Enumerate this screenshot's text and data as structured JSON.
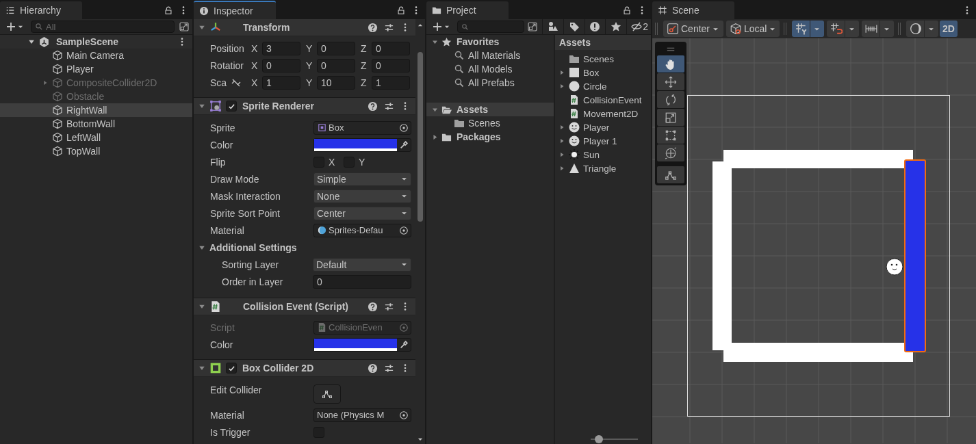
{
  "hierarchy": {
    "title": "Hierarchy",
    "search_placeholder": "All",
    "scene": {
      "name": "SampleScene",
      "expanded": true,
      "children": [
        {
          "name": "Main Camera",
          "selected": false,
          "active": true,
          "expandable": false
        },
        {
          "name": "Player",
          "selected": false,
          "active": true,
          "expandable": false
        },
        {
          "name": "CompositeCollider2D",
          "selected": false,
          "active": false,
          "expandable": true,
          "expanded": false
        },
        {
          "name": "Obstacle",
          "selected": false,
          "active": false,
          "expandable": false
        },
        {
          "name": "RightWall",
          "selected": true,
          "active": true,
          "expandable": false
        },
        {
          "name": "BottomWall",
          "selected": false,
          "active": true,
          "expandable": false
        },
        {
          "name": "LeftWall",
          "selected": false,
          "active": true,
          "expandable": false
        },
        {
          "name": "TopWall",
          "selected": false,
          "active": true,
          "expandable": false
        }
      ]
    }
  },
  "inspector": {
    "title": "Inspector",
    "components": [
      {
        "kind": "transform",
        "title": "Transform",
        "expanded": true,
        "rows": [
          {
            "kind": "vector3",
            "label": "Position",
            "values": [
              {
                "axis": "X",
                "value": "3"
              },
              {
                "axis": "Y",
                "value": "0"
              },
              {
                "axis": "Z",
                "value": "0"
              }
            ]
          },
          {
            "kind": "vector3",
            "label": "Rotatior",
            "values": [
              {
                "axis": "X",
                "value": "0"
              },
              {
                "axis": "Y",
                "value": "0"
              },
              {
                "axis": "Z",
                "value": "0"
              }
            ]
          },
          {
            "kind": "vector3",
            "label": "Sca",
            "ratio_locked": false,
            "values": [
              {
                "axis": "X",
                "value": "1"
              },
              {
                "axis": "Y",
                "value": "10"
              },
              {
                "axis": "Z",
                "value": "1"
              }
            ]
          }
        ]
      },
      {
        "kind": "sprite_renderer",
        "title": "Sprite Renderer",
        "enabled": true,
        "expanded": true,
        "rows": [
          {
            "kind": "sprite_object",
            "label": "Sprite",
            "value": "Box",
            "disabled": false
          },
          {
            "kind": "color",
            "label": "Color",
            "color": "#2632e8"
          },
          {
            "kind": "flip",
            "label": "Flip",
            "options": [
              {
                "axis": "X",
                "checked": false
              },
              {
                "axis": "Y",
                "checked": false
              }
            ]
          },
          {
            "kind": "dropdown",
            "label": "Draw Mode",
            "value": "Simple"
          },
          {
            "kind": "dropdown",
            "label": "Mask Interaction",
            "value": "None"
          },
          {
            "kind": "dropdown",
            "label": "Sprite Sort Point",
            "value": "Center"
          },
          {
            "kind": "material_object",
            "label": "Material",
            "value": "Sprites-Defau",
            "disabled": false
          },
          {
            "kind": "foldout",
            "label": "Additional Settings",
            "expanded": true,
            "children": [
              {
                "kind": "dropdown",
                "label": "Sorting Layer",
                "value": "Default"
              },
              {
                "kind": "number",
                "label": "Order in Layer",
                "value": "0"
              }
            ]
          }
        ]
      },
      {
        "kind": "script",
        "title": "Collision Event (Script)",
        "expanded": true,
        "rows": [
          {
            "kind": "script_object",
            "label": "Script",
            "value": "CollisionEven",
            "disabled": true
          },
          {
            "kind": "color",
            "label": "Color",
            "color": "#2632e8"
          }
        ]
      },
      {
        "kind": "box_collider",
        "title": "Box Collider 2D",
        "enabled": true,
        "expanded": true,
        "rows": [
          {
            "kind": "button",
            "label": "Edit Collider"
          },
          {
            "kind": "object",
            "label": "Material",
            "value": "None (Physics M",
            "disabled": false
          },
          {
            "kind": "checkbox",
            "label": "Is Trigger",
            "checked": false
          }
        ]
      }
    ]
  },
  "project": {
    "title": "Project",
    "hidden_count": "2",
    "tree": [
      {
        "label": "Favorites",
        "kind": "favorites",
        "expanded": true,
        "selected": false,
        "children": [
          {
            "label": "All Materials",
            "kind": "search",
            "selected": false
          },
          {
            "label": "All Models",
            "kind": "search",
            "selected": false
          },
          {
            "label": "All Prefabs",
            "kind": "search",
            "selected": false
          }
        ]
      },
      {
        "label": "Assets",
        "kind": "folder",
        "expanded": true,
        "selected": true,
        "children": [
          {
            "label": "Scenes",
            "kind": "folder",
            "selected": false
          }
        ]
      },
      {
        "label": "Packages",
        "kind": "folder",
        "expanded": false,
        "selected": false
      }
    ],
    "breadcrumb": "Assets",
    "assets": [
      {
        "name": "Scenes",
        "kind": "folder",
        "expandable": false
      },
      {
        "name": "Box",
        "kind": "square",
        "expandable": true
      },
      {
        "name": "Circle",
        "kind": "circle",
        "expandable": true
      },
      {
        "name": "CollisionEvent",
        "kind": "script",
        "expandable": false
      },
      {
        "name": "Movement2D",
        "kind": "script",
        "expandable": false
      },
      {
        "name": "Player",
        "kind": "face",
        "expandable": true
      },
      {
        "name": "Player 1",
        "kind": "face",
        "expandable": true
      },
      {
        "name": "Sun",
        "kind": "sun",
        "expandable": true
      },
      {
        "name": "Triangle",
        "kind": "triangle",
        "expandable": true
      }
    ],
    "icon_size": {
      "level": 0.08
    }
  },
  "scene": {
    "title": "Scene",
    "toolbar": [
      {
        "kind": "pivot",
        "label": "Center"
      },
      {
        "kind": "space",
        "label": "Local"
      },
      {
        "kind": "grid",
        "selected": true
      },
      {
        "kind": "snap",
        "selected": false
      },
      {
        "kind": "increment",
        "selected": false
      },
      {
        "kind": "shading",
        "selected": false
      },
      {
        "kind": "mode2d",
        "label": "2D",
        "selected": true
      }
    ],
    "tools": [
      {
        "kind": "hand",
        "selected": true
      },
      {
        "kind": "move",
        "selected": false
      },
      {
        "kind": "rotate",
        "selected": false
      },
      {
        "kind": "scale",
        "selected": false
      },
      {
        "kind": "rect",
        "selected": false
      },
      {
        "kind": "transform",
        "selected": false
      },
      {
        "kind": "custom",
        "selected": false
      }
    ]
  }
}
